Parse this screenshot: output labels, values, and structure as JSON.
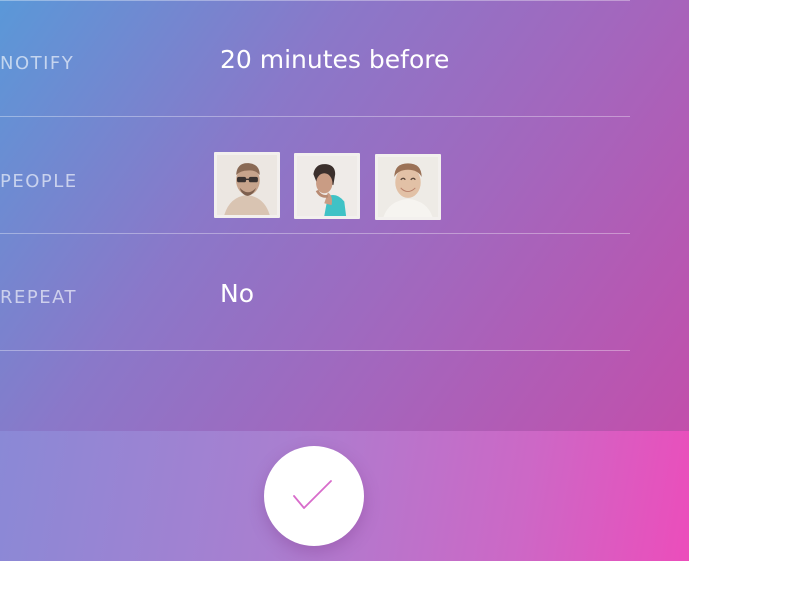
{
  "form": {
    "rows": [
      {
        "label": "NOTIFY",
        "value": "20 minutes before"
      },
      {
        "label": "PEOPLE"
      },
      {
        "label": "REPEAT",
        "value": "No"
      }
    ],
    "people": [
      {
        "name": "avatar-man-sunglasses"
      },
      {
        "name": "avatar-woman-looking-down"
      },
      {
        "name": "avatar-man-smiling"
      }
    ]
  },
  "footer": {
    "confirm_icon": "checkmark-icon"
  },
  "colors": {
    "gradient_start": "#5a98d8",
    "gradient_end": "#c24fab",
    "footer_gradient_end": "#ec4dbb",
    "checkmark": "#d86ccb"
  }
}
